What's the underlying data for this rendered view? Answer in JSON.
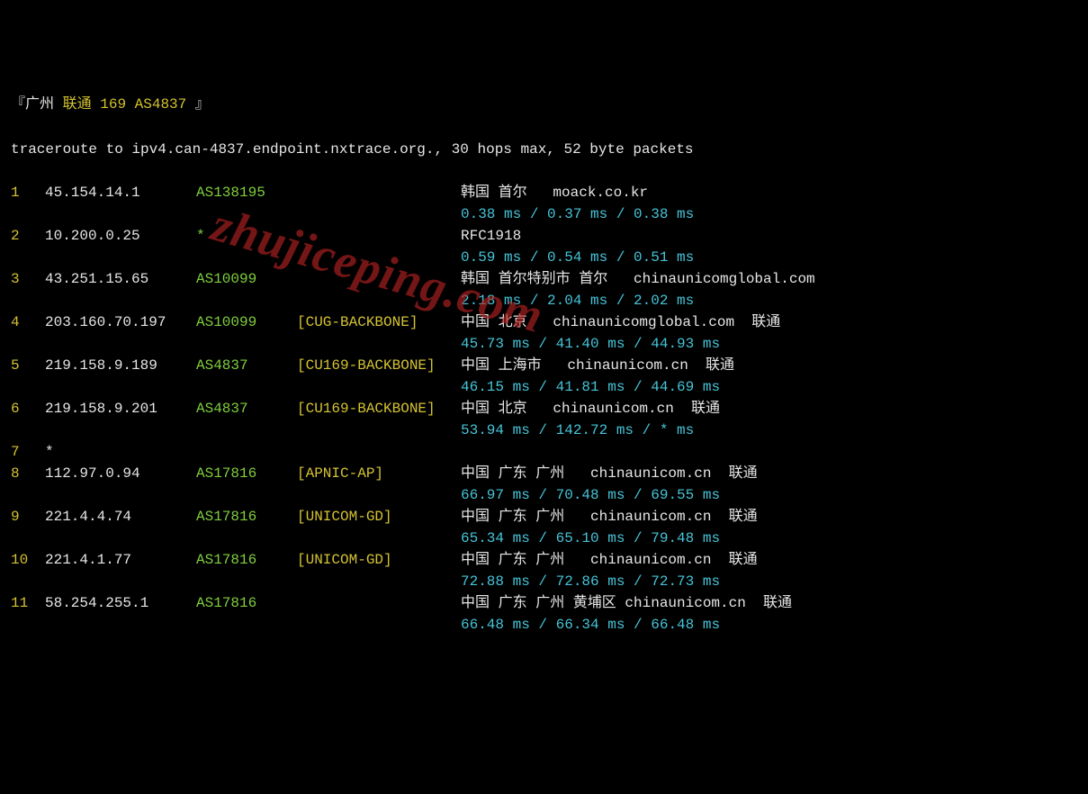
{
  "header": {
    "open_bracket": "『",
    "city": "广州 ",
    "isp": "联通 ",
    "circuit": "169 AS4837 ",
    "close_bracket": "』"
  },
  "trace_line": "traceroute to ipv4.can-4837.endpoint.nxtrace.org., 30 hops max, 52 byte packets",
  "watermark": "zhujiceping.com",
  "hops": [
    {
      "num": "1",
      "ip": "45.154.14.1",
      "asn": "AS138195",
      "tag": "",
      "loc": "韩国 首尔   moack.co.kr",
      "times": "0.38 ms / 0.37 ms / 0.38 ms"
    },
    {
      "num": "2",
      "ip": "10.200.0.25",
      "asn": "*",
      "tag": "",
      "loc": "RFC1918",
      "times": "0.59 ms / 0.54 ms / 0.51 ms"
    },
    {
      "num": "3",
      "ip": "43.251.15.65",
      "asn": "AS10099",
      "tag": "",
      "loc": "韩国 首尔特别市 首尔   chinaunicomglobal.com",
      "times": "2.18 ms / 2.04 ms / 2.02 ms"
    },
    {
      "num": "4",
      "ip": "203.160.70.197",
      "asn": "AS10099",
      "tag": "[CUG-BACKBONE]",
      "loc": "中国 北京   chinaunicomglobal.com  联通",
      "times": "45.73 ms / 41.40 ms / 44.93 ms"
    },
    {
      "num": "5",
      "ip": "219.158.9.189",
      "asn": "AS4837",
      "tag": "[CU169-BACKBONE]",
      "loc": "中国 上海市   chinaunicom.cn  联通",
      "times": "46.15 ms / 41.81 ms / 44.69 ms"
    },
    {
      "num": "6",
      "ip": "219.158.9.201",
      "asn": "AS4837",
      "tag": "[CU169-BACKBONE]",
      "loc": "中国 北京   chinaunicom.cn  联通",
      "times": "53.94 ms / 142.72 ms / * ms"
    },
    {
      "num": "7",
      "ip": "*",
      "asn": "",
      "tag": "",
      "loc": "",
      "times": ""
    },
    {
      "num": "8",
      "ip": "112.97.0.94",
      "asn": "AS17816",
      "tag": "[APNIC-AP]",
      "loc": "中国 广东 广州   chinaunicom.cn  联通",
      "times": "66.97 ms / 70.48 ms / 69.55 ms"
    },
    {
      "num": "9",
      "ip": "221.4.4.74",
      "asn": "AS17816",
      "tag": "[UNICOM-GD]",
      "loc": "中国 广东 广州   chinaunicom.cn  联通",
      "times": "65.34 ms / 65.10 ms / 79.48 ms"
    },
    {
      "num": "10",
      "ip": "221.4.1.77",
      "asn": "AS17816",
      "tag": "[UNICOM-GD]",
      "loc": "中国 广东 广州   chinaunicom.cn  联通",
      "times": "72.88 ms / 72.86 ms / 72.73 ms"
    },
    {
      "num": "11",
      "ip": "58.254.255.1",
      "asn": "AS17816",
      "tag": "",
      "loc": "中国 广东 广州 黄埔区 chinaunicom.cn  联通",
      "times": "66.48 ms / 66.34 ms / 66.48 ms"
    }
  ]
}
